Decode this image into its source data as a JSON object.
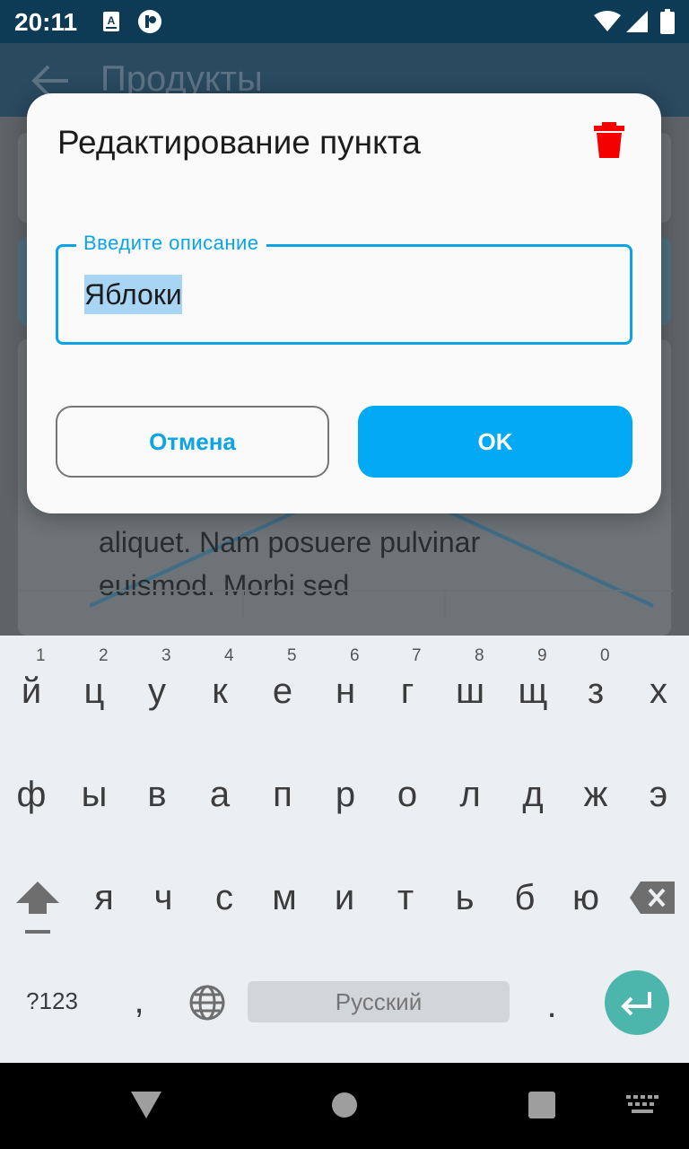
{
  "status_bar": {
    "time": "20:11",
    "icons": [
      "keyboard-a-icon",
      "app-notification-icon",
      "wifi-icon",
      "signal-icon",
      "battery-icon"
    ]
  },
  "app_bar": {
    "title": "Продукты",
    "back_icon": "arrow-back-icon"
  },
  "background": {
    "text": "aliquet. Nam posuere pulvinar euismod. Morbi sed"
  },
  "dialog": {
    "title": "Редактирование пункта",
    "delete_icon": "trash-icon",
    "input": {
      "label": "Введите описание",
      "value": "Яблоки"
    },
    "cancel_label": "Отмена",
    "ok_label": "OK"
  },
  "keyboard": {
    "row1": [
      {
        "key": "й",
        "hint": "1"
      },
      {
        "key": "ц",
        "hint": "2"
      },
      {
        "key": "у",
        "hint": "3"
      },
      {
        "key": "к",
        "hint": "4"
      },
      {
        "key": "е",
        "hint": "5"
      },
      {
        "key": "н",
        "hint": "6"
      },
      {
        "key": "г",
        "hint": "7"
      },
      {
        "key": "ш",
        "hint": "8"
      },
      {
        "key": "щ",
        "hint": "9"
      },
      {
        "key": "з",
        "hint": "0"
      },
      {
        "key": "х",
        "hint": ""
      }
    ],
    "row2": [
      "ф",
      "ы",
      "в",
      "а",
      "п",
      "р",
      "о",
      "л",
      "д",
      "ж",
      "э"
    ],
    "row3": [
      "я",
      "ч",
      "с",
      "м",
      "и",
      "т",
      "ь",
      "б",
      "ю"
    ],
    "symbols_label": "?123",
    "comma": ",",
    "space_label": "Русский",
    "period": "."
  },
  "colors": {
    "accent": "#03a9f4",
    "delete": "#f50000",
    "enter": "#4db6ac"
  }
}
